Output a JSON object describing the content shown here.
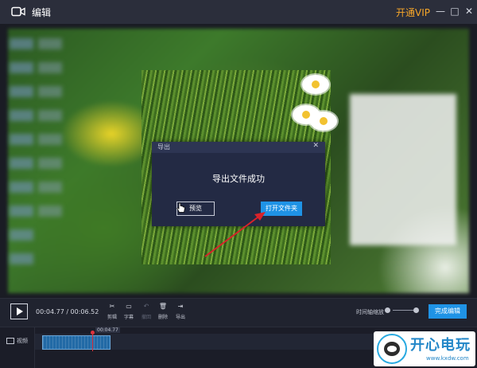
{
  "window": {
    "title": "编辑",
    "vip_label": "开通VIP",
    "controls": {
      "minimize": "—",
      "maximize": "□",
      "close": "✕"
    }
  },
  "dialog": {
    "title": "导出",
    "close": "✕",
    "message": "导出文件成功",
    "preview_button": "预览",
    "open_folder_button": "打开文件夹"
  },
  "player": {
    "time_display": "00:04.77 / 00:06.52"
  },
  "toolbar": {
    "items": [
      {
        "icon": "scissors-icon",
        "glyph": "✂",
        "label": "剪辑",
        "enabled": true
      },
      {
        "icon": "subtitle-icon",
        "glyph": "▭",
        "label": "字幕",
        "enabled": true
      },
      {
        "icon": "undo-icon",
        "glyph": "↶",
        "label": "撤回",
        "enabled": false
      },
      {
        "icon": "trash-icon",
        "glyph": "🗑",
        "label": "删除",
        "enabled": true
      },
      {
        "icon": "export-icon",
        "glyph": "⇥",
        "label": "导出",
        "enabled": true
      }
    ]
  },
  "zoom": {
    "label": "时间轴缩放"
  },
  "done_button": "完成编辑",
  "timeline": {
    "track_label": "视频",
    "playhead_time": "00:04.77"
  },
  "watermark": {
    "brand": "开心电玩",
    "url": "www.kxdw.com"
  },
  "colors": {
    "accent": "#1f93e6",
    "vip": "#f7a629",
    "playhead": "#e0333d"
  }
}
